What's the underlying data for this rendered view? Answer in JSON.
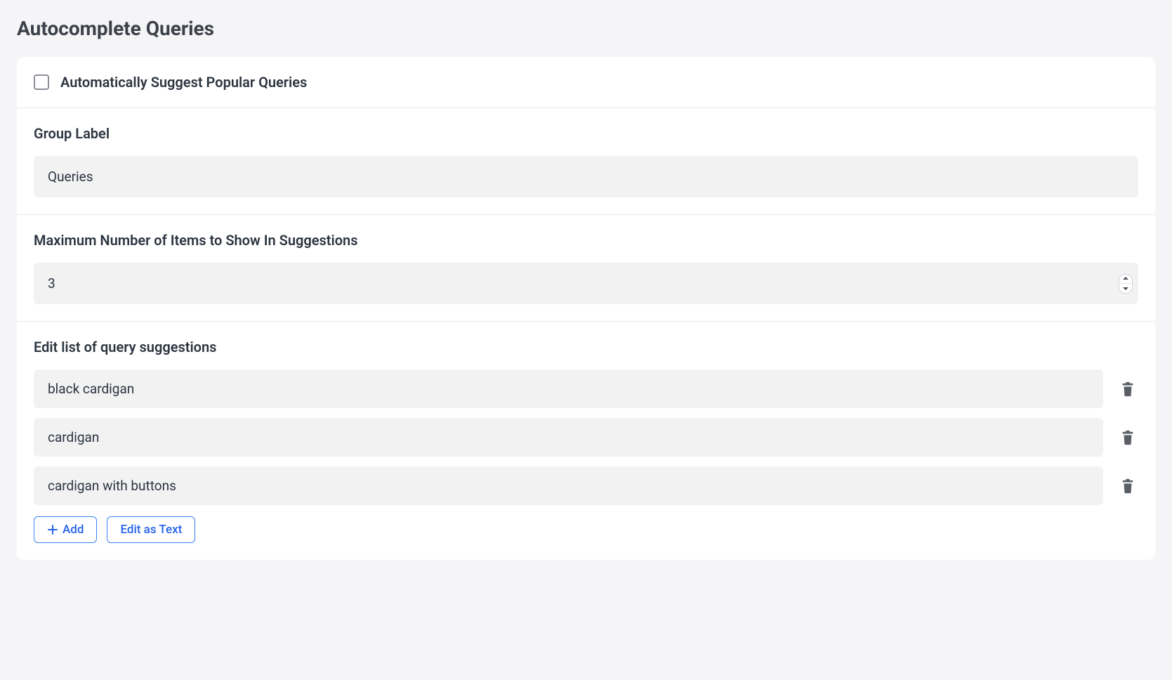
{
  "page_title": "Autocomplete Queries",
  "auto_suggest": {
    "label": "Automatically Suggest Popular Queries",
    "checked": false
  },
  "group_label_field": {
    "label": "Group Label",
    "value": "Queries"
  },
  "max_items_field": {
    "label": "Maximum Number of Items to Show In Suggestions",
    "value": "3"
  },
  "suggestions": {
    "label": "Edit list of query suggestions",
    "items": [
      "black cardigan",
      "cardigan",
      "cardigan with buttons"
    ]
  },
  "buttons": {
    "add": "Add",
    "edit_as_text": "Edit as Text"
  }
}
